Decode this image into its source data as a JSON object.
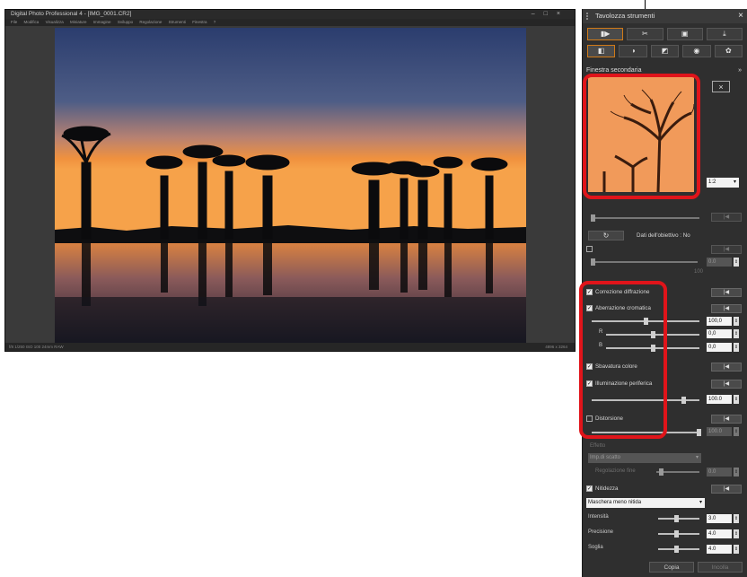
{
  "main_window": {
    "title": "Digital Photo Professional 4 - [IMG_0001.CR2]",
    "window_controls": [
      "–",
      "□",
      "×"
    ],
    "menu": [
      "File",
      "Modifica",
      "Visualizza",
      "Miniature",
      "Immagine",
      "Sviluppo",
      "Regolazione",
      "Strumenti",
      "Finestra",
      "?"
    ],
    "status_left": "f/8  1/250  ISO 100  24mm  RAW",
    "status_right": "4896 x 3264"
  },
  "palette": {
    "title": "Tavolozza strumenti",
    "close_label": "×",
    "tabs_row1": [
      "▮▶",
      "✂",
      "▣",
      "⤓"
    ],
    "tabs_row2": [
      "◧",
      "◑",
      "◩",
      "◉",
      "✿"
    ],
    "section_header": "Finestra secondaria",
    "section_chevron": "»",
    "close_preview": "×",
    "zoom_value": "1:2",
    "lens_label": "Dati dell'obiettivo : No",
    "chrom_value": "0.0",
    "chrom_max": "100",
    "diffraction_label": "Correzione diffrazione",
    "aberration_label": "Aberrazione cromatica",
    "aberration_value": "100,0",
    "r_label": "R",
    "r_value": "0,0",
    "b_label": "B",
    "b_value": "0,0",
    "color_blur_label": "Sbavatura colore",
    "peripheral_label": "Illuminazione periferica",
    "peripheral_value": "100.0",
    "distortion_label": "Distorsione",
    "distortion_value": "100.0",
    "effect_label": "Effetto",
    "effect_dropdown": "Imp.di scatto",
    "fine_tune_label": "Regolazione fine",
    "fine_tune_value": "0.0",
    "sharpness_label": "Nitidezza",
    "sharpness_dropdown": "Maschera meno nitida",
    "intensity_label": "Intensità",
    "intensity_value": "3.0",
    "fineness_label": "Precisione",
    "fineness_value": "4.0",
    "threshold_label": "Soglia",
    "threshold_value": "4.0",
    "copy_button": "Copia",
    "paste_button": "Incolla",
    "reset_icon": "|◀"
  },
  "colors": {
    "accent": "#d07a18",
    "highlight": "#e0141a",
    "panel": "#2f2f2f"
  }
}
